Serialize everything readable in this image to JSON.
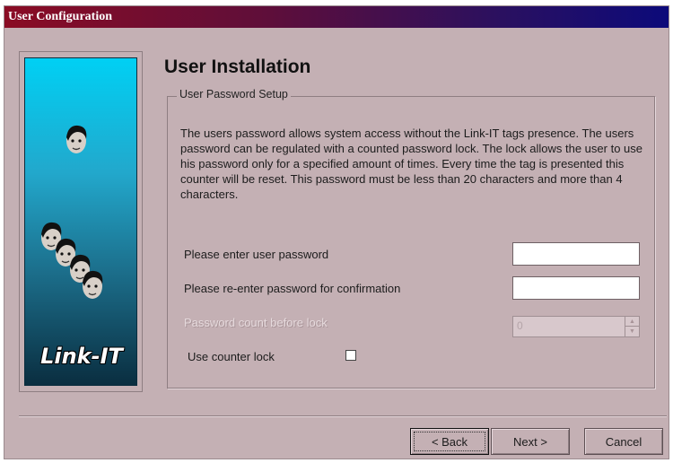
{
  "window": {
    "title": "User Configuration"
  },
  "sidebar": {
    "logo_text": "Link-IT"
  },
  "main": {
    "heading": "User Installation",
    "group_title": "User Password Setup",
    "description": "The users password allows system access without the Link-IT tags presence.  The users password can be regulated with a counted password lock.  The lock allows the user to use his password only for a specified amount of times.  Every time the tag is presented this counter will be reset.  This password must be less than 20 characters and more than 4 characters.",
    "password_label": "Please enter user password",
    "password_value": "",
    "confirm_label": "Please re-enter password for confirmation",
    "confirm_value": "",
    "count_label": "Password count before lock",
    "count_value": "0",
    "counter_lock_label": "Use counter lock",
    "counter_lock_checked": false
  },
  "buttons": {
    "back": "< Back",
    "next": "Next >",
    "cancel": "Cancel"
  },
  "colors": {
    "window_bg": "#c4b0b4",
    "title_gradient_start": "#8a0c24",
    "title_gradient_end": "#0c0a7a",
    "side_gradient_top": "#00d0f4",
    "side_gradient_bottom": "#0a2e40"
  }
}
